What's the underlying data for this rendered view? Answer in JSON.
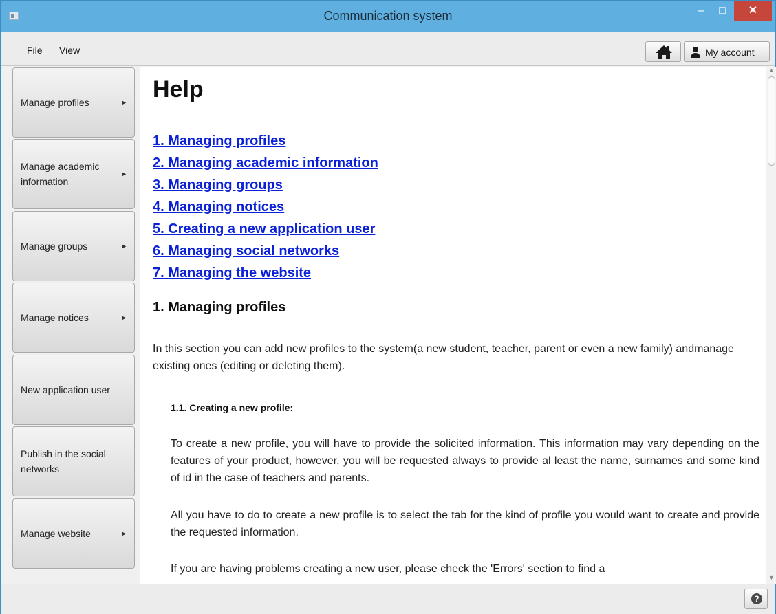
{
  "window": {
    "title": "Communication system",
    "minimize_glyph": "–",
    "maximize_glyph": "□",
    "close_glyph": "✕"
  },
  "menubar": {
    "file_label": "File",
    "view_label": "View"
  },
  "toolbar": {
    "account_label": "My account",
    "home_icon": "home-icon",
    "account_icon": "user-icon"
  },
  "sidebar": {
    "items": [
      {
        "label": "Manage profiles",
        "has_submenu": true
      },
      {
        "label": "Manage academic information",
        "has_submenu": true
      },
      {
        "label": "Manage groups",
        "has_submenu": true
      },
      {
        "label": "Manage notices",
        "has_submenu": true
      },
      {
        "label": "New application user",
        "has_submenu": false
      },
      {
        "label": "Publish in the social networks",
        "has_submenu": false
      },
      {
        "label": "Manage website",
        "has_submenu": true
      }
    ],
    "submenu_glyph": "►"
  },
  "help": {
    "title": "Help",
    "toc": [
      "1. Managing profiles",
      "2. Managing academic information",
      "3. Managing groups",
      "4. Managing notices",
      "5. Creating a new application user",
      "6. Managing social networks",
      "7. Managing the website"
    ],
    "section1_title": "1. Managing profiles",
    "section1_intro": "In this section you can add new profiles to the system(a new student, teacher, parent or even a new family) andmanage existing ones (editing or deleting them).",
    "subsection_title": "1.1. Creating a new profile:",
    "para1": "To create a new profile, you will have to provide the solicited information. This information may vary depending on the features of your product, however, you will be requested always to provide al least the name, surnames and some kind of id in the case of teachers and parents.",
    "para2": "All you have to do to create a new profile is to select the tab for the kind of profile you would want to create and provide the requested information.",
    "para3": "If you are having problems creating a new user, please check the 'Errors' section to find a"
  },
  "statusbar": {
    "help_glyph": "?"
  },
  "colors": {
    "titlebar": "#5fb0e0",
    "link": "#0a21d8",
    "close_button": "#c7463c"
  }
}
